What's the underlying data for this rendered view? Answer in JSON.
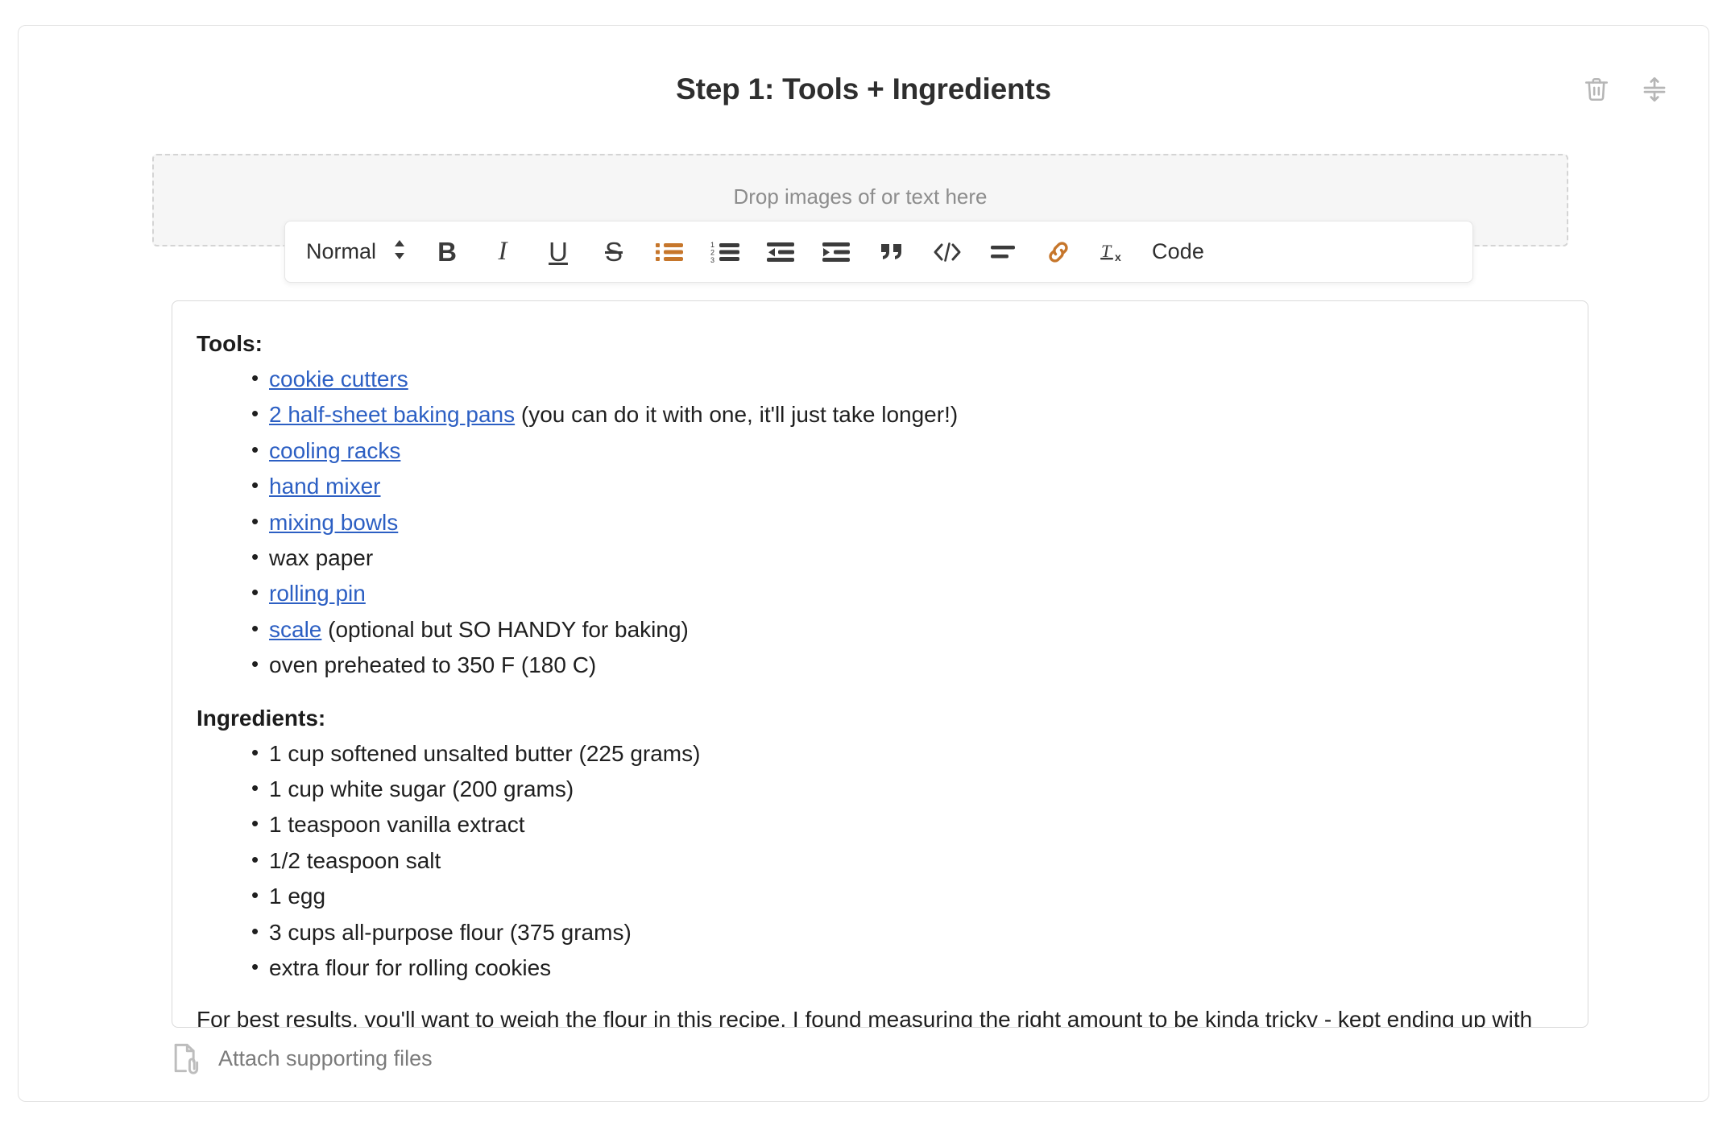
{
  "header": {
    "title": "Step 1: Tools + Ingredients",
    "delete_icon_name": "trash-icon",
    "move_icon_name": "move-vertical-icon"
  },
  "dropzone": {
    "text": "Drop images of or text here"
  },
  "toolbar": {
    "style_label": "Normal",
    "buttons": [
      {
        "name": "bold-button",
        "label": "B"
      },
      {
        "name": "italic-button",
        "label": "I"
      },
      {
        "name": "underline-button",
        "label": "U"
      },
      {
        "name": "strikethrough-button",
        "label": "S"
      },
      {
        "name": "bullet-list-button",
        "label": ""
      },
      {
        "name": "numbered-list-button",
        "label": ""
      },
      {
        "name": "outdent-button",
        "label": ""
      },
      {
        "name": "indent-button",
        "label": ""
      },
      {
        "name": "blockquote-button",
        "label": ""
      },
      {
        "name": "code-block-button",
        "label": ""
      },
      {
        "name": "align-button",
        "label": ""
      },
      {
        "name": "link-button",
        "label": ""
      },
      {
        "name": "clear-formatting-button",
        "label": ""
      }
    ],
    "code_label": "Code",
    "active_color": "#c6762b"
  },
  "editor": {
    "tools_heading": "Tools:",
    "tools": [
      {
        "link": "cookie cutters",
        "rest": ""
      },
      {
        "link": "2 half-sheet baking pans",
        "rest": " (you can do it with one, it'll just take longer!)"
      },
      {
        "link": "cooling racks",
        "rest": ""
      },
      {
        "link": "hand mixer",
        "rest": ""
      },
      {
        "link": "mixing bowls",
        "rest": ""
      },
      {
        "link": "",
        "rest": "wax paper"
      },
      {
        "link": "rolling pin",
        "rest": ""
      },
      {
        "link": "scale",
        "rest": " (optional but SO HANDY for baking)"
      },
      {
        "link": "",
        "rest": "oven preheated to 350 F (180 C)"
      }
    ],
    "ingredients_heading": "Ingredients:",
    "ingredients": [
      "1 cup softened unsalted butter (225 grams)",
      "1 cup white sugar (200 grams)",
      "1 teaspoon vanilla extract",
      "1/2 teaspoon salt",
      "1 egg",
      "3 cups all-purpose flour (375 grams)",
      "extra flour for rolling cookies"
    ],
    "note": "For best results, you'll want to weigh the flour in this recipe. I found measuring the right amount to be kinda tricky - kept ending up with more than I needed. :D",
    "link_color": "#2c5fc3"
  },
  "attach": {
    "label": "Attach supporting files",
    "icon_name": "file-attach-icon"
  }
}
